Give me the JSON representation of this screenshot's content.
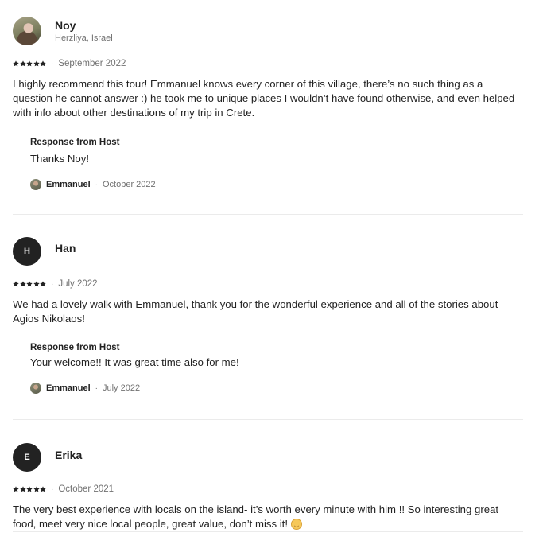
{
  "reviews": [
    {
      "name": "Noy",
      "location": "Herzliya, Israel",
      "avatar_initial": "",
      "rating": 5,
      "date": "September 2022",
      "text": "I highly recommend this tour! Emmanuel knows every corner of this village, there’s no such thing as a question he cannot answer :) he took me to unique places I wouldn’t have found otherwise, and even helped with info about other destinations of my trip in Crete.",
      "response": {
        "title": "Response from Host",
        "text": "Thanks Noy!",
        "host_name": "Emmanuel",
        "date": "October 2022"
      }
    },
    {
      "name": "Han",
      "location": "",
      "avatar_initial": "H",
      "rating": 5,
      "date": "July 2022",
      "text": "We had a lovely walk with Emmanuel, thank you for the wonderful experience and all of the stories about Agios Nikolaos!",
      "response": {
        "title": "Response from Host",
        "text": "Your welcome!! It was great time also for me!",
        "host_name": "Emmanuel",
        "date": "July 2022"
      }
    },
    {
      "name": "Erika",
      "location": "",
      "avatar_initial": "E",
      "rating": 5,
      "date": "October 2021",
      "text": "The very best experience with locals on the island- it’s worth every minute with him !! So interesting great food, meet very nice local people, great value, don’t miss it!"
    }
  ],
  "separator": "·",
  "colors": {
    "text": "#222222",
    "muted": "#717171",
    "divider": "#ebebeb",
    "avatar_bg": "#222222"
  },
  "icons": {
    "rating": "star-icon",
    "emoji": "smiling-face-emoji"
  }
}
